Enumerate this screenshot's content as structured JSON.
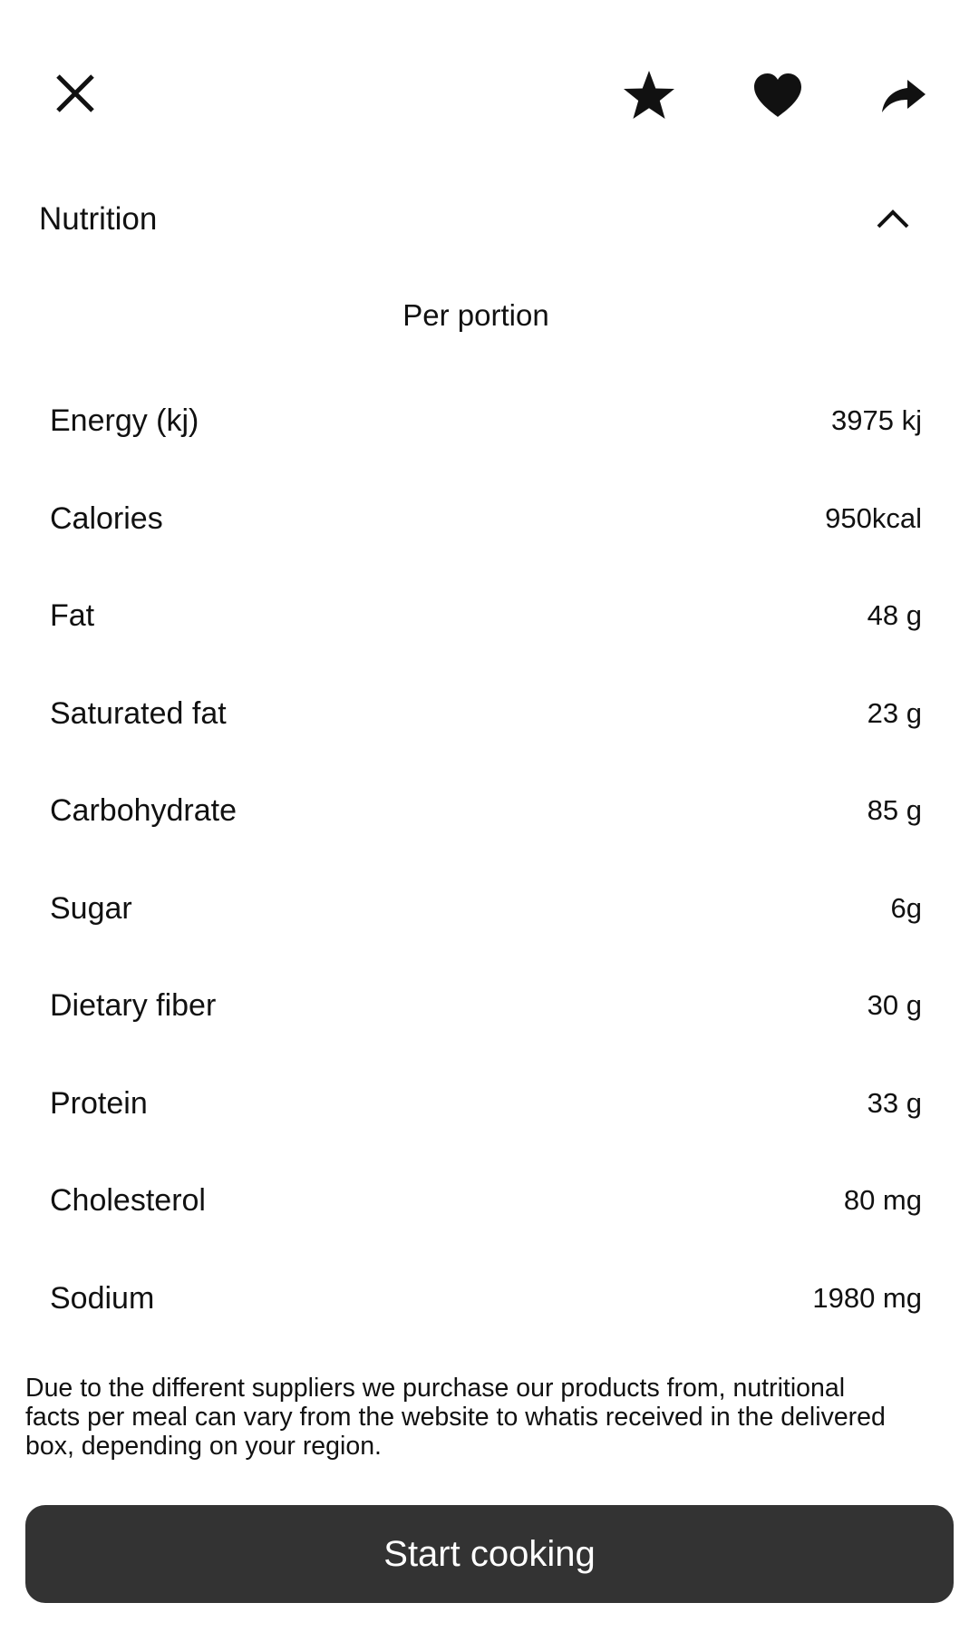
{
  "toolbar": {
    "close_icon": "close-icon",
    "favorite_icon": "star-icon",
    "like_icon": "heart-icon",
    "share_icon": "share-icon"
  },
  "nutrition": {
    "title": "Nutrition",
    "toggle_icon": "chevron-up-icon",
    "subtitle": "Per portion",
    "items": [
      {
        "label": "Energy (kj)",
        "value": "3975 kj"
      },
      {
        "label": "Calories",
        "value": "950kcal"
      },
      {
        "label": "Fat",
        "value": "48 g"
      },
      {
        "label": "Saturated fat",
        "value": "23 g"
      },
      {
        "label": "Carbohydrate",
        "value": "85 g"
      },
      {
        "label": "Sugar",
        "value": "6g"
      },
      {
        "label": "Dietary fiber",
        "value": "30 g"
      },
      {
        "label": "Protein",
        "value": "33 g"
      },
      {
        "label": "Cholesterol",
        "value": "80 mg"
      },
      {
        "label": "Sodium",
        "value": "1980 mg"
      }
    ],
    "disclaimer": "Due to the different suppliers we purchase our products from, nutritional facts per meal can vary from the website to whatis received in the delivered box, depending on your region."
  },
  "actions": {
    "start_label": "Start cooking"
  },
  "colors": {
    "button_background": "#333333",
    "button_text": "#ffffff",
    "text": "#111111",
    "background": "#ffffff"
  }
}
